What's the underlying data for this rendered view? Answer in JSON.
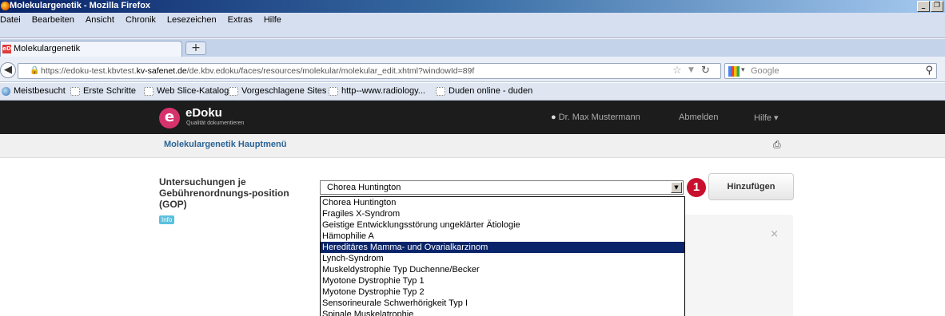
{
  "window": {
    "title": "Molekulargenetik - Mozilla Firefox"
  },
  "menu": [
    "Datei",
    "Bearbeiten",
    "Ansicht",
    "Chronik",
    "Lesezeichen",
    "Extras",
    "Hilfe"
  ],
  "tab": {
    "label": "Molekulargenetik",
    "favicon": "eD"
  },
  "address": {
    "prefix": "https://edoku-test.kbvtest.",
    "domain": "kv-safenet.de",
    "path": "/de.kbv.edoku/faces/resources/molekular/molekular_edit.xhtml?windowId=89f"
  },
  "search": {
    "engine": "Google"
  },
  "bookmarks": [
    "Meistbesucht",
    "Erste Schritte",
    "Web Slice-Katalog",
    "Vorgeschlagene Sites",
    "http--www.radiology...",
    "Duden online - duden"
  ],
  "app": {
    "logo_name": "eDoku",
    "logo_sub": "Qualität dokumentieren",
    "user": "Dr. Max Mustermann",
    "logout": "Abmelden",
    "help": "Hilfe ▾",
    "subtitle": "Molekulargenetik Hauptmenü"
  },
  "form": {
    "label": "Untersuchungen je Gebührenordnungs-position (GOP)",
    "info_badge": "Info",
    "selected_value": "Chorea Huntington",
    "add_button": "Hinzufügen",
    "marker": "1",
    "options": [
      "Chorea Huntington",
      "Fragiles X-Syndrom",
      "Geistige Entwicklungsstörung ungeklärter Ätiologie",
      "Hämophilie A",
      "Hereditäres Mamma- und Ovarialkarzinom",
      "Lynch-Syndrom",
      "Muskeldystrophie Typ Duchenne/Becker",
      "Myotone Dystrophie Typ 1",
      "Myotone Dystrophie Typ 2",
      "Sensorineurale Schwerhörigkeit Typ I",
      "Spinale Muskelatrophie"
    ],
    "highlighted_option": "Hereditäres Mamma- und Ovarialkarzinom"
  },
  "colors": {
    "nav_bg": "#1c1c1c",
    "logo": "#d6336c",
    "link": "#2a6496",
    "highlight": "#0a246a",
    "marker": "#c8102e"
  }
}
